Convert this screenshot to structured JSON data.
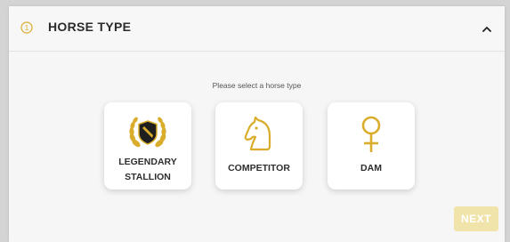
{
  "section": {
    "step_number": "1",
    "title": "HORSE TYPE",
    "collapse_icon": "chevron-up-icon"
  },
  "prompt": "Please select a horse type",
  "options": [
    {
      "label_line1": "LEGENDARY",
      "label_line2": "STALLION",
      "icon": "laurel-badge-icon"
    },
    {
      "label": "COMPETITOR",
      "icon": "horse-head-icon"
    },
    {
      "label": "DAM",
      "icon": "female-symbol-icon"
    }
  ],
  "next_label": "NEXT",
  "colors": {
    "accent_gold": "#d9ad2b",
    "next_button_disabled": "#f1e4aa",
    "text_dark": "#2b2b2b"
  }
}
